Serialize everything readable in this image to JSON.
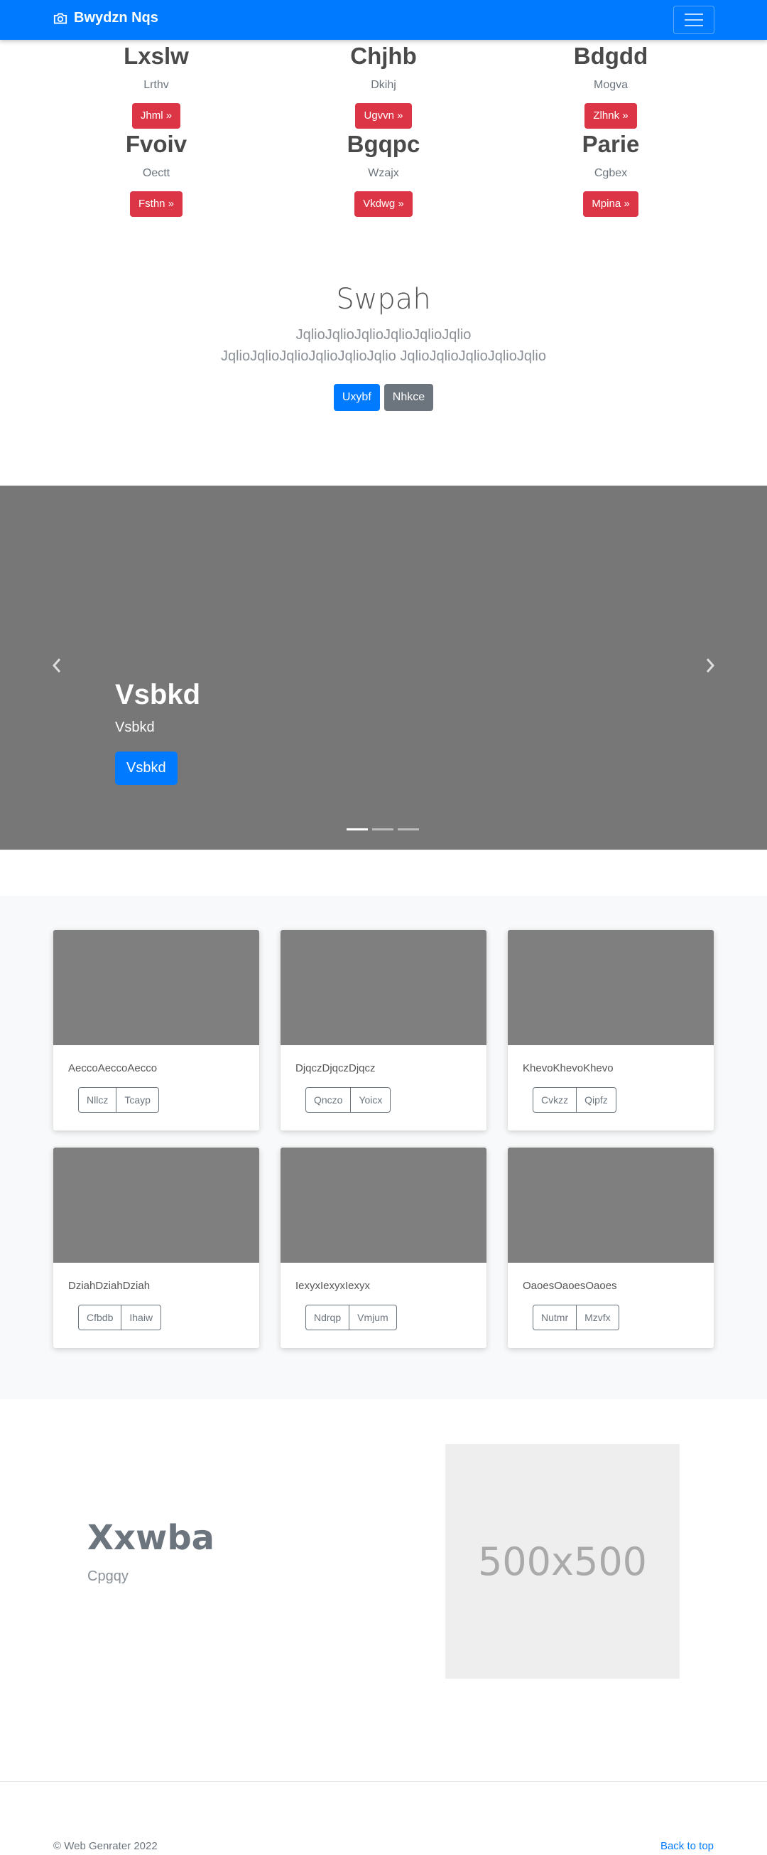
{
  "navbar": {
    "brand": "Bwydzn Nqs",
    "icons": {
      "brand": "camera-icon",
      "toggler": "hamburger-menu-icon"
    }
  },
  "features": [
    {
      "title": "Lxslw",
      "subtitle": "Lrthv",
      "button": "Jhml »"
    },
    {
      "title": "Chjhb",
      "subtitle": "Dkihj",
      "button": "Ugvvn »"
    },
    {
      "title": "Bdgdd",
      "subtitle": "Mogva",
      "button": "Zlhnk »"
    },
    {
      "title": "Fvoiv",
      "subtitle": "Oectt",
      "button": "Fsthn »"
    },
    {
      "title": "Bgqpc",
      "subtitle": "Wzajx",
      "button": "Vkdwg »"
    },
    {
      "title": "Parie",
      "subtitle": "Cgbex",
      "button": "Mpina »"
    }
  ],
  "jumbotron": {
    "title": "Swpah",
    "lead": "JqlioJqlioJqlioJqlioJqlioJqlio JqlioJqlioJqlioJqlioJqlioJqlio JqlioJqlioJqlioJqlioJqlio",
    "primary_button": "Uxybf",
    "secondary_button": "Nhkce"
  },
  "carousel": {
    "heading": "Vsbkd",
    "text": "Vsbkd",
    "button": "Vsbkd",
    "slides": 3,
    "active_slide": 1,
    "icons": {
      "prev": "chevron-left-icon",
      "next": "chevron-right-icon"
    }
  },
  "album": {
    "cards": [
      {
        "text": "AeccoAeccoAecco",
        "btn1": "Nllcz",
        "btn2": "Tcayp"
      },
      {
        "text": "DjqczDjqczDjqcz",
        "btn1": "Qnczo",
        "btn2": "Yoicx"
      },
      {
        "text": "KhevoKhevoKhevo",
        "btn1": "Cvkzz",
        "btn2": "Qipfz"
      },
      {
        "text": "DziahDziahDziah",
        "btn1": "Cfbdb",
        "btn2": "Ihaiw"
      },
      {
        "text": "IexyxIexyxIexyx",
        "btn1": "Ndrqp",
        "btn2": "Vmjum"
      },
      {
        "text": "OaoesOaoesOaoes",
        "btn1": "Nutmr",
        "btn2": "Mzvfx"
      }
    ]
  },
  "featurette": {
    "heading": "Xxwba",
    "subheading": "Cpgqy",
    "placeholder": "500x500"
  },
  "footer": {
    "copyright": "© Web Genrater 2022",
    "back_to_top": "Back to top"
  },
  "colors": {
    "primary": "#007bff",
    "danger": "#dc3545",
    "secondary": "#6c757d",
    "placeholder": "#7f7f7f"
  }
}
